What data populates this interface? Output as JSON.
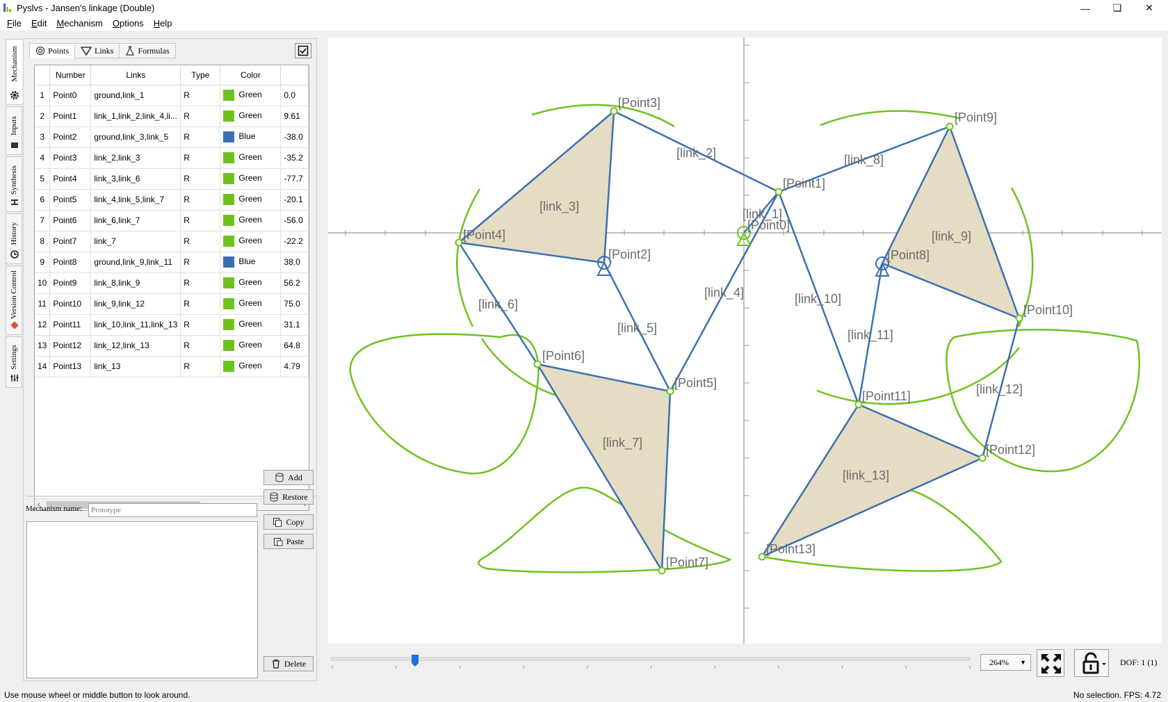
{
  "window": {
    "title": "Pyslvs - Jansen's linkage (Double)"
  },
  "menu": [
    {
      "label": "File",
      "u": "F",
      "rest": "ile"
    },
    {
      "label": "Edit",
      "u": "E",
      "rest": "dit"
    },
    {
      "label": "Mechanism",
      "u": "M",
      "rest": "echanism"
    },
    {
      "label": "Options",
      "u": "O",
      "rest": "ptions"
    },
    {
      "label": "Help",
      "u": "H",
      "rest": "elp"
    }
  ],
  "side_tabs": [
    "Mechanism",
    "Inputs",
    "Synthesis",
    "History",
    "Version Control",
    "Settings"
  ],
  "sub_tabs": [
    "Points",
    "Links",
    "Formulas"
  ],
  "table": {
    "headers": [
      "Number",
      "Links",
      "Type",
      "Color",
      ""
    ],
    "rows": [
      {
        "n": "1",
        "number": "Point0",
        "links": "ground,link_1",
        "type": "R",
        "color": "Green",
        "hex": "#6ec21e",
        "x": "0.0"
      },
      {
        "n": "2",
        "number": "Point1",
        "links": "link_1,link_2,link_4,li...",
        "type": "R",
        "color": "Green",
        "hex": "#6ec21e",
        "x": "9.61"
      },
      {
        "n": "3",
        "number": "Point2",
        "links": "ground,link_3,link_5",
        "type": "R",
        "color": "Blue",
        "hex": "#3c6fb2",
        "x": "-38.0"
      },
      {
        "n": "4",
        "number": "Point3",
        "links": "link_2,link_3",
        "type": "R",
        "color": "Green",
        "hex": "#6ec21e",
        "x": "-35.2"
      },
      {
        "n": "5",
        "number": "Point4",
        "links": "link_3,link_6",
        "type": "R",
        "color": "Green",
        "hex": "#6ec21e",
        "x": "-77.7"
      },
      {
        "n": "6",
        "number": "Point5",
        "links": "link_4,link_5,link_7",
        "type": "R",
        "color": "Green",
        "hex": "#6ec21e",
        "x": "-20.1"
      },
      {
        "n": "7",
        "number": "Point6",
        "links": "link_6,link_7",
        "type": "R",
        "color": "Green",
        "hex": "#6ec21e",
        "x": "-56.0"
      },
      {
        "n": "8",
        "number": "Point7",
        "links": "link_7",
        "type": "R",
        "color": "Green",
        "hex": "#6ec21e",
        "x": "-22.2"
      },
      {
        "n": "9",
        "number": "Point8",
        "links": "ground,link_9,link_11",
        "type": "R",
        "color": "Blue",
        "hex": "#3c6fb2",
        "x": "38.0"
      },
      {
        "n": "10",
        "number": "Point9",
        "links": "link_8,link_9",
        "type": "R",
        "color": "Green",
        "hex": "#6ec21e",
        "x": "56.2"
      },
      {
        "n": "11",
        "number": "Point10",
        "links": "link_9,link_12",
        "type": "R",
        "color": "Green",
        "hex": "#6ec21e",
        "x": "75.0"
      },
      {
        "n": "12",
        "number": "Point11",
        "links": "link_10,link_11,link_13",
        "type": "R",
        "color": "Green",
        "hex": "#6ec21e",
        "x": "31.1"
      },
      {
        "n": "13",
        "number": "Point12",
        "links": "link_12,link_13",
        "type": "R",
        "color": "Green",
        "hex": "#6ec21e",
        "x": "64.8"
      },
      {
        "n": "14",
        "number": "Point13",
        "links": "link_13",
        "type": "R",
        "color": "Green",
        "hex": "#6ec21e",
        "x": "4.79"
      }
    ]
  },
  "mechanism": {
    "name_label": "Mechanism name:",
    "name_placeholder": "Prototype",
    "buttons": {
      "add": "Add",
      "restore": "Restore",
      "copy": "Copy",
      "paste": "Paste",
      "delete": "Delete"
    }
  },
  "zoom": "264%",
  "dof": "DOF:  1 (1)",
  "status": {
    "left": "Use mouse wheel or middle button to look around.",
    "right": "No selection.  FPS:  4.72"
  },
  "colors": {
    "link": "#3c6fb2",
    "path": "#6ec21e",
    "fill": "#e4dcc3",
    "label": "#6b6b6b"
  },
  "canvas": {
    "point_labels": [
      "[Point0]",
      "[Point1]",
      "[Point2]",
      "[Point3]",
      "[Point4]",
      "[Point5]",
      "[Point6]",
      "[Point7]",
      "[Point8]",
      "[Point9]",
      "[Point10]",
      "[Point11]",
      "[Point12]",
      "[Point13]"
    ],
    "link_labels": [
      "[link_1]",
      "[link_2]",
      "[link_3]",
      "[link_4]",
      "[link_5]",
      "[link_6]",
      "[link_7]",
      "[link_8]",
      "[link_9]",
      "[link_10]",
      "[link_11]",
      "[link_12]",
      "[link_13]"
    ]
  }
}
